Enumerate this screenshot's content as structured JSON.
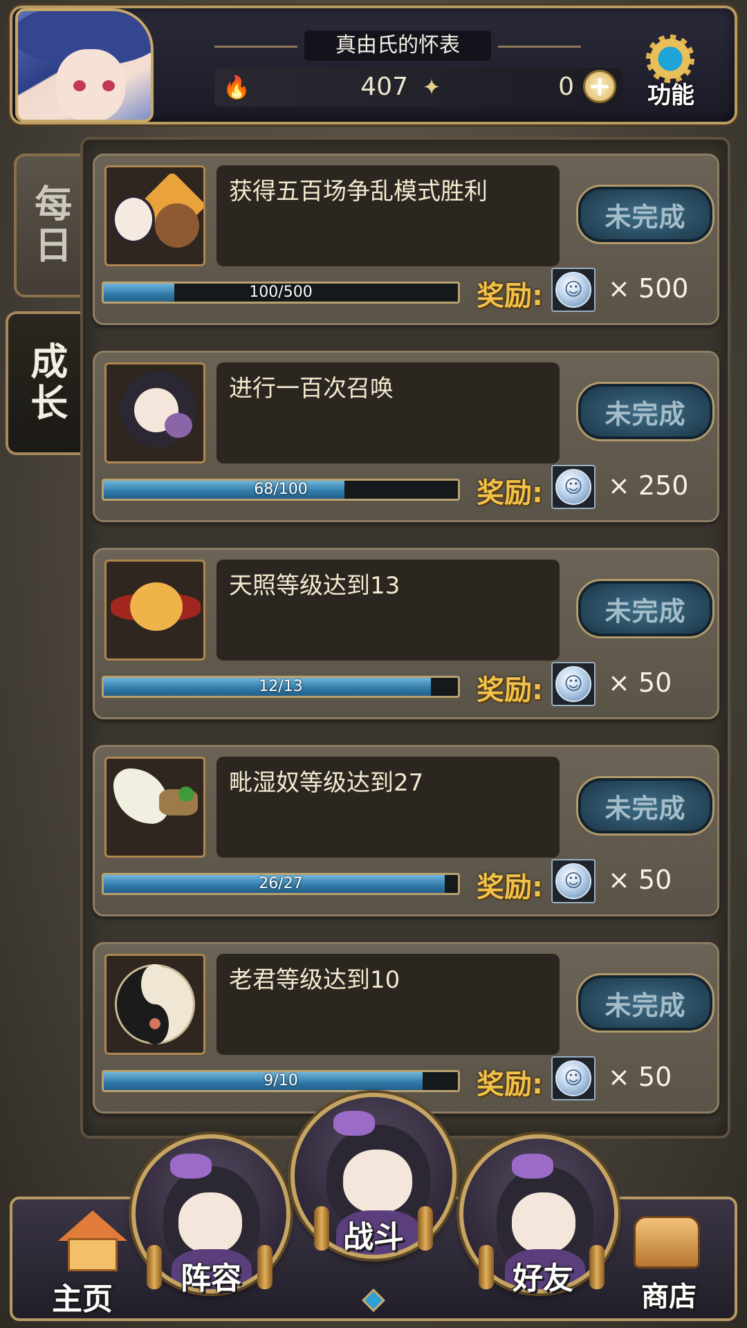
{
  "header": {
    "player_name": "真由氏的怀表",
    "currency_1": {
      "icon": "flame-icon",
      "value": "407"
    },
    "currency_2": {
      "icon": "butterfly-icon",
      "value": "0"
    },
    "plus_label": "+",
    "function_label": "功能"
  },
  "tabs": [
    {
      "label": "每日",
      "active": false
    },
    {
      "label": "成长",
      "active": true
    }
  ],
  "quests": [
    {
      "description": "获得五百场争乱模式胜利",
      "status": "未完成",
      "progress_text": "100/500",
      "progress": 0.2,
      "reward_label": "奖励:",
      "reward_count": "× 500"
    },
    {
      "description": "进行一百次召唤",
      "status": "未完成",
      "progress_text": "68/100",
      "progress": 0.68,
      "reward_label": "奖励:",
      "reward_count": "× 250"
    },
    {
      "description": "天照等级达到13",
      "status": "未完成",
      "progress_text": "12/13",
      "progress": 0.923,
      "reward_label": "奖励:",
      "reward_count": "× 50"
    },
    {
      "description": "毗湿奴等级达到27",
      "status": "未完成",
      "progress_text": "26/27",
      "progress": 0.963,
      "reward_label": "奖励:",
      "reward_count": "× 50"
    },
    {
      "description": "老君等级达到10",
      "status": "未完成",
      "progress_text": "9/10",
      "progress": 0.9,
      "reward_label": "奖励:",
      "reward_count": "× 50"
    }
  ],
  "nav": {
    "home": "主页",
    "team": "阵容",
    "battle": "战斗",
    "friends": "好友",
    "shop": "商店"
  },
  "colors": {
    "accent_gold": "#c9a968",
    "reward_gold": "#f2c14a",
    "progress_blue": "#2f79a8",
    "status_blue": "#254458"
  }
}
